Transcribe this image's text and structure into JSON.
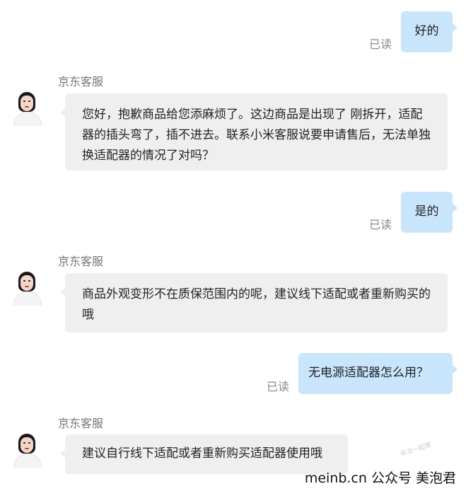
{
  "messages": {
    "m1": {
      "text": "好的",
      "status": "已读"
    },
    "m2": {
      "agent": "京东客服",
      "text": "您好，抱歉商品给您添麻烦了。这边商品是出现了 刚拆开，适配器的插头弯了，插不进去。联系小米客服说要申请售后，无法单独换适配器的情况了对吗？"
    },
    "m3": {
      "text": "是的",
      "status": "已读"
    },
    "m4": {
      "agent": "京东客服",
      "text": "商品外观变形不在质保范围内的呢，建议线下适配或者重新购买的哦"
    },
    "m5": {
      "text": "无电源适配器怎么用？",
      "status": "已读"
    },
    "m6": {
      "agent": "京东客服",
      "text": "建议自行线下适配或者重新购买适配器使用哦"
    }
  },
  "watermark": {
    "text": "meinb.cn  公众号 美泡君",
    "faint": "有没一起赚"
  },
  "colors": {
    "outgoing_bubble": "#c9e5fb",
    "incoming_bubble": "#efefef",
    "status_text": "#8a8a8a",
    "agent_name": "#777777"
  },
  "icons": {
    "agent_avatar": "customer-service-avatar-icon"
  }
}
